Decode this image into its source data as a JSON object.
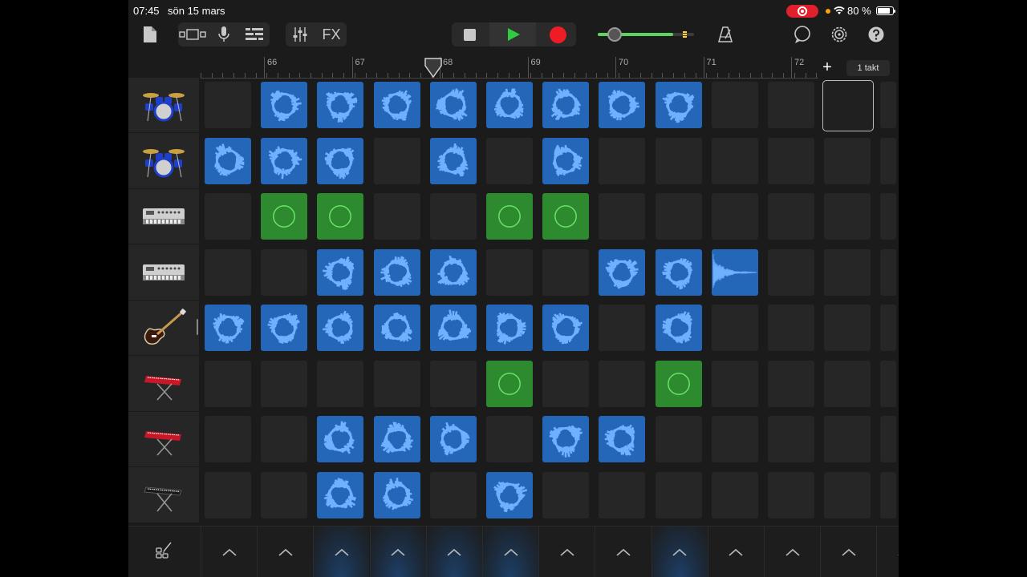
{
  "status_bar": {
    "time": "07:45",
    "date": "sön 15 mars",
    "battery": "80 %"
  },
  "toolbar": {
    "fx_label": "FX",
    "icons": [
      "document-icon",
      "view-toggle-icon",
      "microphone-icon",
      "tracks-view-icon",
      "mixer-icon",
      "fx",
      "stop-icon",
      "play-icon",
      "record-icon",
      "metronome-icon",
      "loop-browser-icon",
      "settings-icon",
      "help-icon"
    ],
    "colors": {
      "play": "#2ecc40",
      "record": "#ee1c24",
      "volume": "#5fd35f"
    }
  },
  "transport": {
    "volume_level": 0.78
  },
  "ruler": {
    "bars": [
      "66",
      "67",
      "68",
      "69",
      "70",
      "71",
      "72"
    ],
    "playhead_bar": 67.93
  },
  "bar_length_label": "1 takt",
  "add_label": "+",
  "tracks": [
    {
      "instrument": "drum-kit"
    },
    {
      "instrument": "drum-kit"
    },
    {
      "instrument": "drum-machine"
    },
    {
      "instrument": "drum-machine"
    },
    {
      "instrument": "electric-guitar"
    },
    {
      "instrument": "red-keyboard"
    },
    {
      "instrument": "red-keyboard"
    },
    {
      "instrument": "black-keyboard"
    }
  ],
  "cells": [
    [
      "e",
      "b",
      "b",
      "b",
      "b",
      "b",
      "b",
      "b",
      "b",
      "e",
      "e",
      "s",
      "e"
    ],
    [
      "b",
      "b",
      "b",
      "e",
      "b",
      "e",
      "b",
      "e",
      "e",
      "e",
      "e",
      "e",
      "e"
    ],
    [
      "e",
      "g",
      "g",
      "e",
      "e",
      "g",
      "g",
      "e",
      "e",
      "e",
      "e",
      "e",
      "e"
    ],
    [
      "e",
      "e",
      "b",
      "b",
      "b",
      "e",
      "e",
      "b",
      "b",
      "w",
      "e",
      "e",
      "e"
    ],
    [
      "b",
      "b",
      "b",
      "b",
      "b",
      "b",
      "b",
      "e",
      "b",
      "e",
      "e",
      "e",
      "e"
    ],
    [
      "e",
      "e",
      "e",
      "e",
      "e",
      "g",
      "e",
      "e",
      "g",
      "e",
      "e",
      "e",
      "e"
    ],
    [
      "e",
      "e",
      "b",
      "b",
      "b",
      "e",
      "b",
      "b",
      "e",
      "e",
      "e",
      "e",
      "e"
    ],
    [
      "e",
      "e",
      "b",
      "b",
      "e",
      "b",
      "e",
      "e",
      "e",
      "e",
      "e",
      "e",
      "e"
    ]
  ],
  "trigger_columns_active": [
    false,
    false,
    true,
    true,
    true,
    true,
    false,
    false,
    true,
    false,
    false,
    false,
    false
  ],
  "colors": {
    "blue_cell": "#2466b8",
    "green_cell": "#2e8a2e",
    "empty_cell": "#262626",
    "wave_blue": "#6fb0ff",
    "wave_green": "#6ee86e"
  }
}
